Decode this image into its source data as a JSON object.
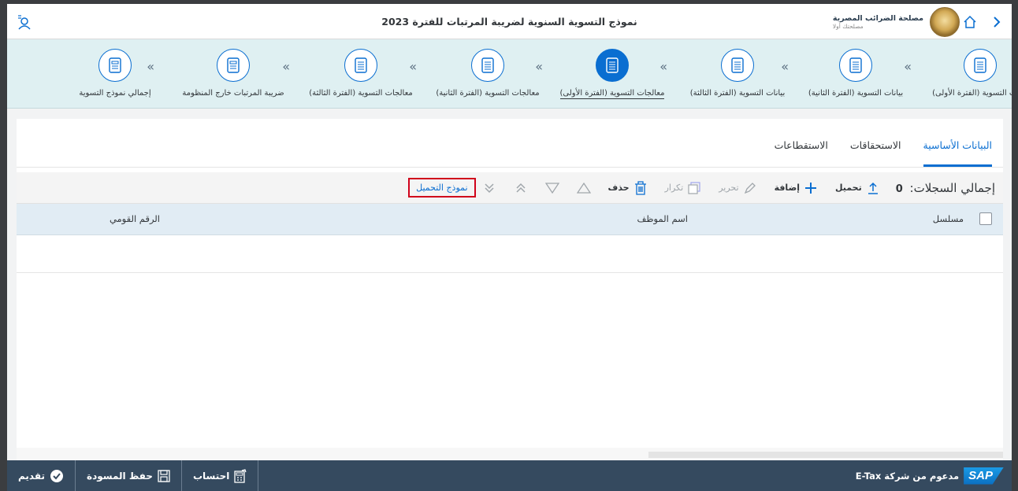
{
  "shell": {
    "title": "نموذج التسوية السنوية لضريبة المرتبات للفترة 2023",
    "org_name": "مصلحة الضرائب المصرية",
    "org_tagline": "مصلحتك أولا"
  },
  "wizard": {
    "steps": [
      {
        "label": "بيانات التسوية (الفترة الأولى)",
        "icon": "document-list-icon"
      },
      {
        "label": "بيانات التسوية (الفترة الثانية)",
        "icon": "document-list-icon"
      },
      {
        "label": "بيانات التسوية (الفترة الثالثة)",
        "icon": "document-list-icon"
      },
      {
        "label": "معالجات التسوية (الفترة الأولى)",
        "icon": "document-list-icon",
        "active": true
      },
      {
        "label": "معالجات التسوية (الفترة الثانية)",
        "icon": "document-list-icon"
      },
      {
        "label": "معالجات التسوية (الفترة الثالثة)",
        "icon": "document-list-icon"
      },
      {
        "label": "ضريبة المرتبات خارج المنظومة",
        "icon": "document-icon"
      },
      {
        "label": "إجمالي نموذج التسوية",
        "icon": "document-icon"
      }
    ]
  },
  "tabs": [
    {
      "label": "البيانات الأساسية",
      "active": true
    },
    {
      "label": "الاستحقاقات"
    },
    {
      "label": "الاستقطاعات"
    }
  ],
  "toolbar": {
    "count_label": "إجمالي السجلات:",
    "count_value": "0",
    "upload": "تحميل",
    "add": "إضافة",
    "edit": "تحرير",
    "duplicate": "تكرار",
    "delete": "حذف",
    "template_link": "نموذج التحميل"
  },
  "table": {
    "columns": [
      "مسلسل",
      "اسم الموظف",
      "الرقم القومي"
    ]
  },
  "footer": {
    "submit": "تقديم",
    "save_draft": "حفظ المسودة",
    "calculate": "احتساب",
    "powered_by": "مدعوم من شركة E-Tax",
    "sap": "SAP"
  },
  "colors": {
    "accent": "#0a6ed1",
    "wizard_bg": "#dff0f2",
    "footer_bg": "#354a5f",
    "highlight_border": "#d0021b"
  }
}
